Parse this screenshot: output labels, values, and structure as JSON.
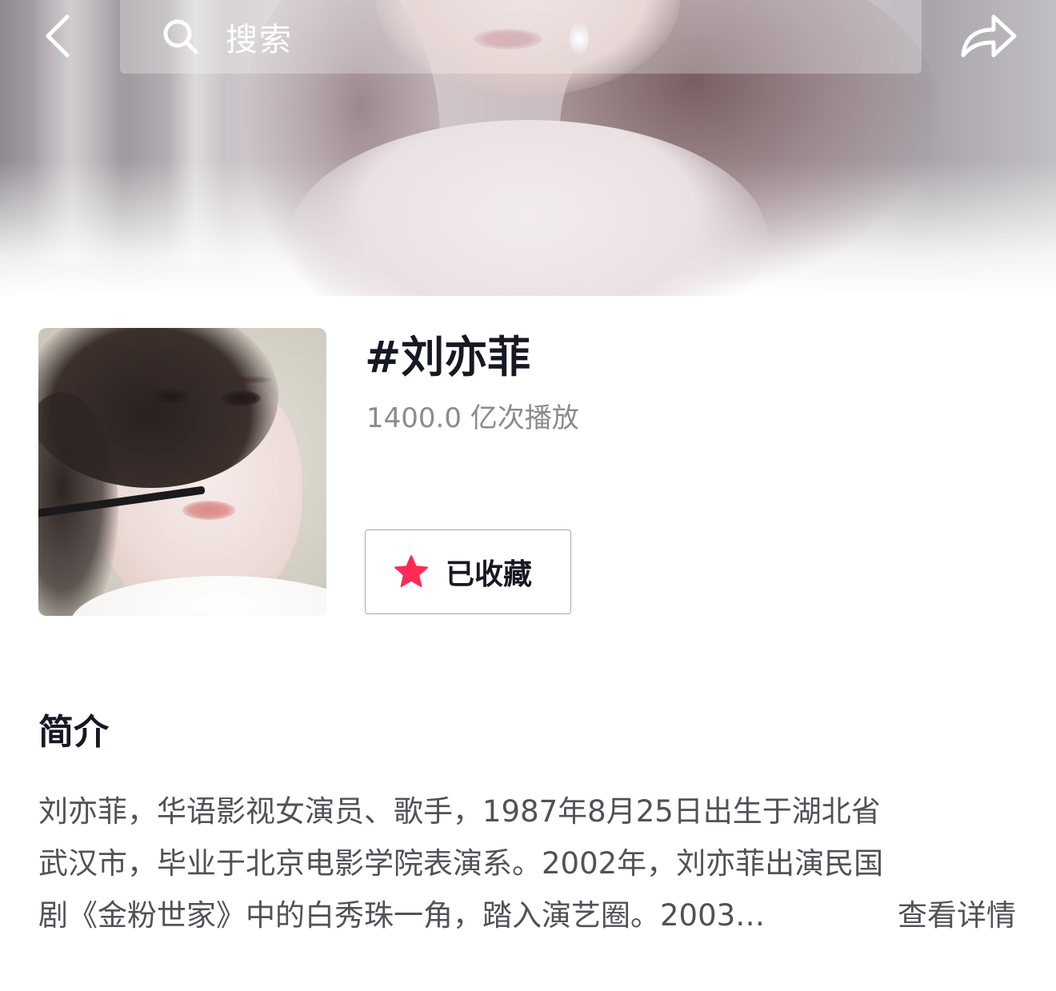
{
  "header": {
    "search_placeholder": "搜索",
    "icons": {
      "back": "chevron-left-icon",
      "search": "search-icon",
      "share": "share-arrow-icon"
    }
  },
  "topic": {
    "title": "#刘亦菲",
    "play_count": "1400.0 亿次播放",
    "favorite_label": "已收藏",
    "favorite_icon": "star-icon",
    "favorite_icon_color": "#fe2c55"
  },
  "intro": {
    "heading": "简介",
    "lines": [
      "刘亦菲，华语影视女演员、歌手，1987年8月25日出生于湖北省",
      "武汉市，毕业于北京电影学院表演系。2002年，刘亦菲出演民国",
      "剧《金粉世家》中的白秀珠一角，踏入演艺圈。2003…"
    ],
    "detail_link": "查看详情"
  },
  "colors": {
    "text_primary": "#161823",
    "text_secondary": "#8a8b91",
    "accent": "#fe2c55"
  }
}
